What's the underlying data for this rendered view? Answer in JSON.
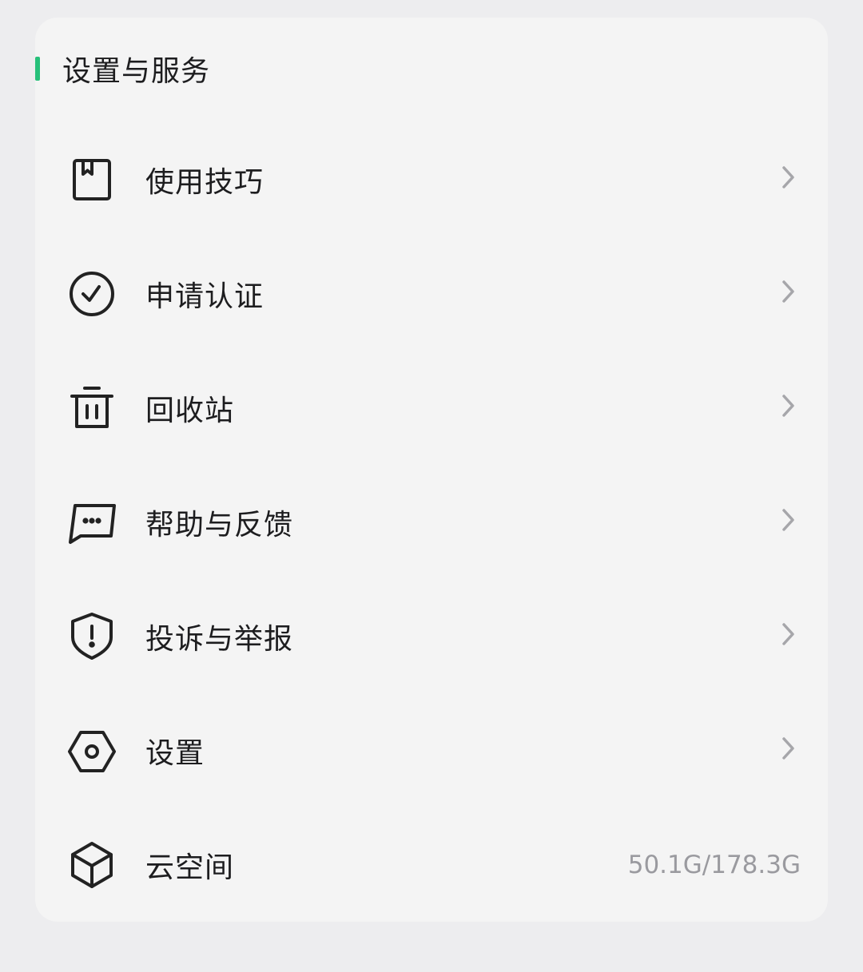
{
  "section": {
    "title": "设置与服务",
    "accent_color": "#27c07a"
  },
  "items": [
    {
      "label": "使用技巧",
      "icon": "book-bookmark-icon",
      "has_chevron": true
    },
    {
      "label": "申请认证",
      "icon": "check-circle-icon",
      "has_chevron": true
    },
    {
      "label": "回收站",
      "icon": "trash-icon",
      "has_chevron": true
    },
    {
      "label": "帮助与反馈",
      "icon": "chat-bubble-icon",
      "has_chevron": true
    },
    {
      "label": "投诉与举报",
      "icon": "shield-alert-icon",
      "has_chevron": true
    },
    {
      "label": "设置",
      "icon": "hexagon-gear-icon",
      "has_chevron": true
    },
    {
      "label": "云空间",
      "icon": "cube-icon",
      "has_chevron": false,
      "value": "50.1G/178.3G"
    }
  ]
}
